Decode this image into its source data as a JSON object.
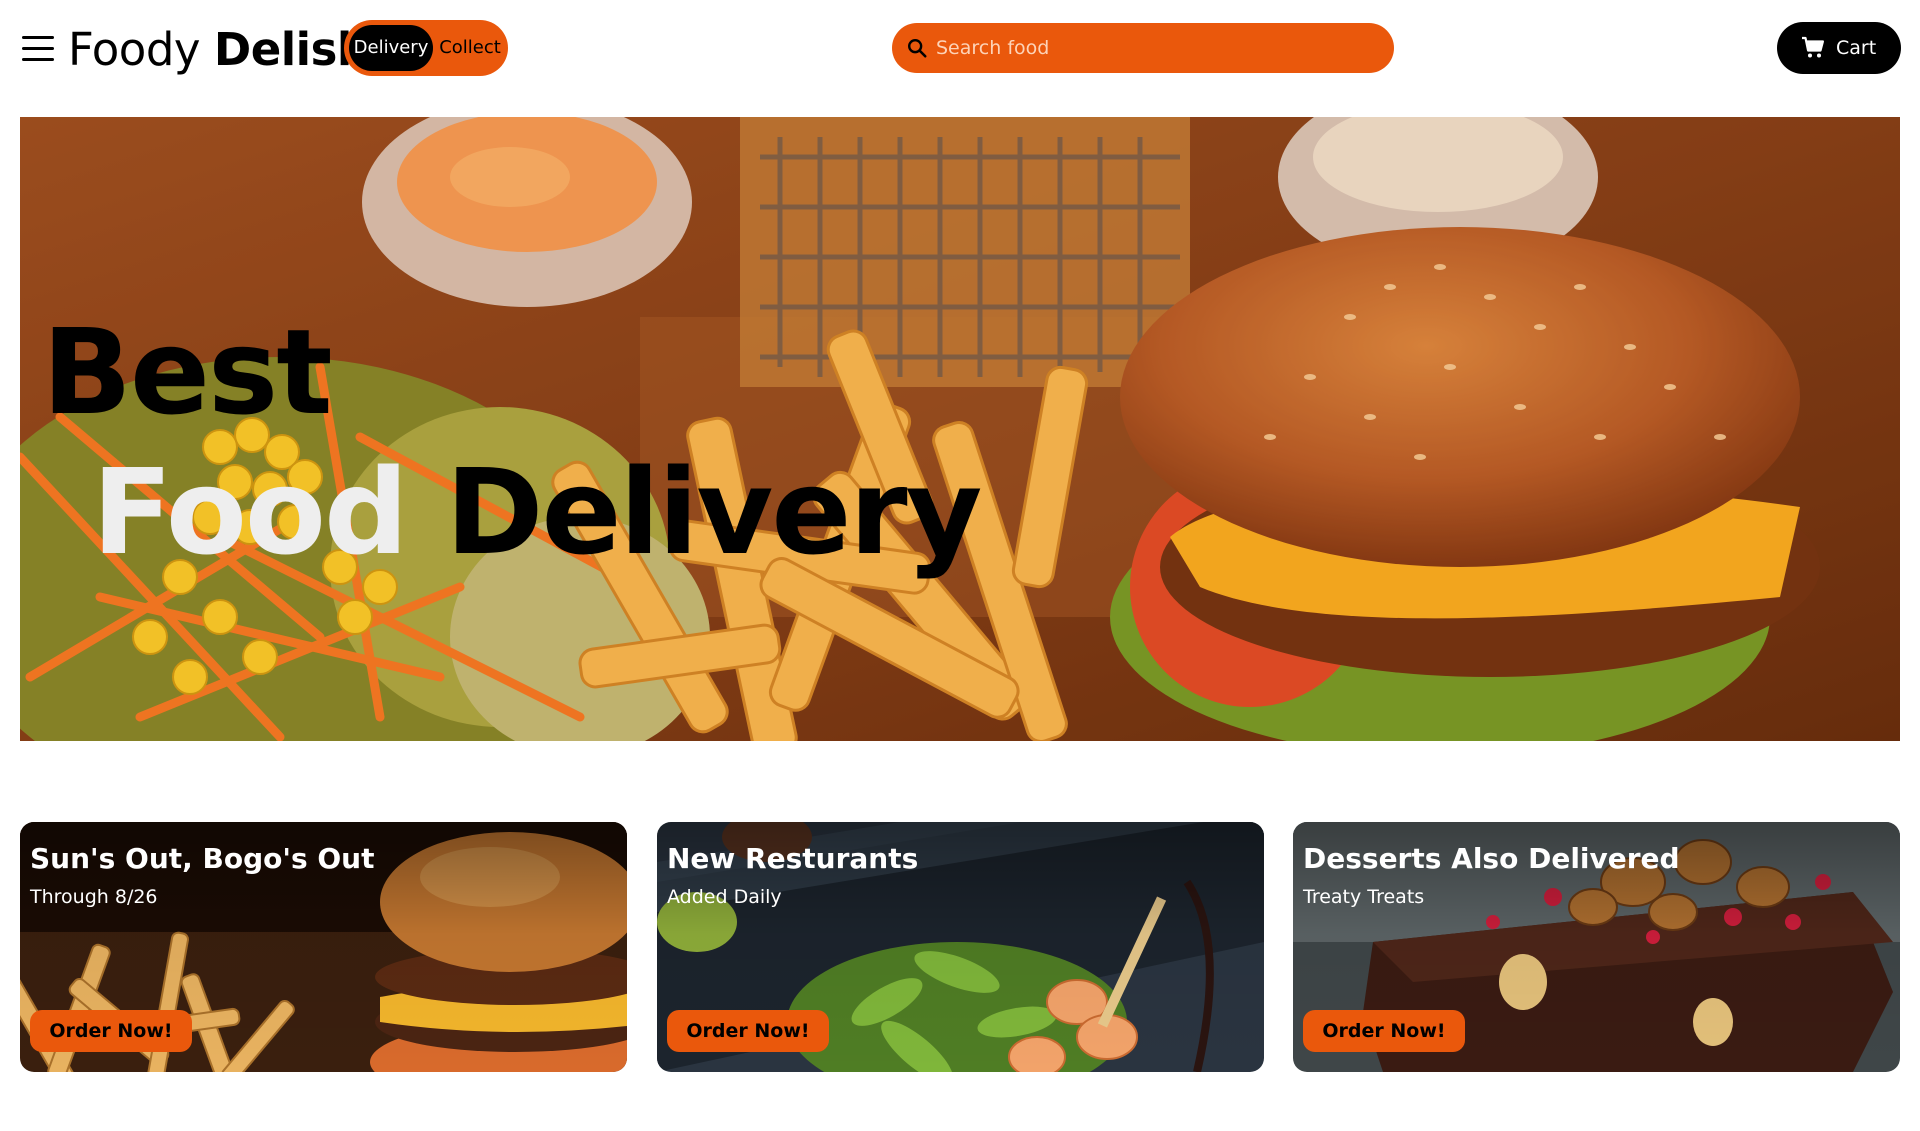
{
  "header": {
    "logo_light": "Foody",
    "logo_bold": "Delish",
    "toggle": {
      "active": "Delivery",
      "inactive": "Collect"
    },
    "search": {
      "placeholder": "Search food",
      "value": ""
    },
    "cart_label": "Cart"
  },
  "hero": {
    "line1": "Best",
    "line2_word1": "Food",
    "line2_word2": "Delivery"
  },
  "cards": [
    {
      "title": "Sun's Out, Bogo's Out",
      "subtitle": "Through 8/26",
      "button": "Order Now!"
    },
    {
      "title": "New Resturants",
      "subtitle": "Added Daily",
      "button": "Order Now!"
    },
    {
      "title": "Desserts Also Delivered",
      "subtitle": "Treaty Treats",
      "button": "Order Now!"
    }
  ],
  "icons": {
    "menu": "hamburger-menu-icon",
    "search": "search-icon",
    "cart": "shopping-cart-icon"
  },
  "colors": {
    "accent": "#ea580c",
    "dark": "#000000",
    "background": "#ffffff"
  }
}
